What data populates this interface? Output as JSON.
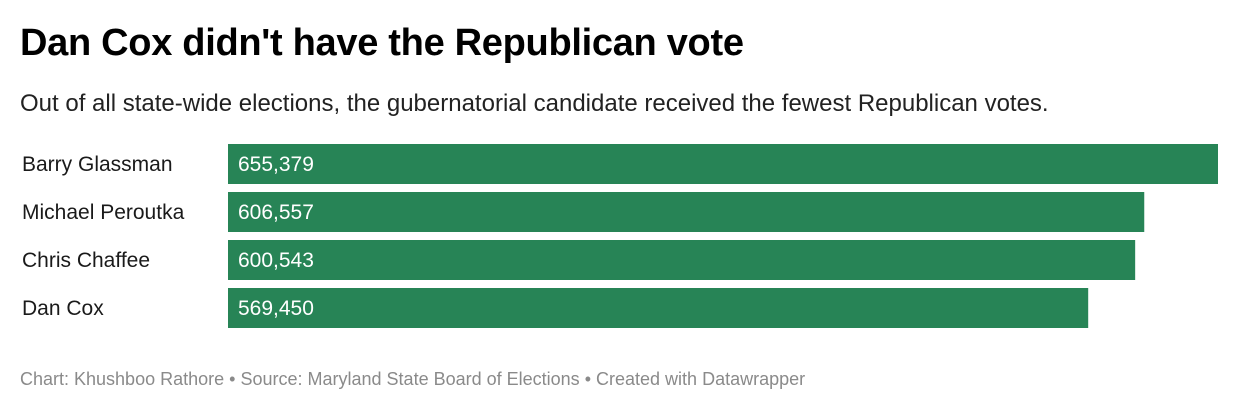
{
  "header": {
    "title": "Dan Cox didn't have the Republican vote",
    "subtitle": "Out of all state-wide elections, the gubernatorial candidate received the fewest Republican votes."
  },
  "footer": {
    "chart_credit": "Chart: Khushboo Rathore",
    "separator": "•",
    "source": "Source: Maryland State Board of Elections",
    "created_with": "Created with Datawrapper"
  },
  "colors": {
    "bar": "#278456",
    "bar_label": "#ffffff",
    "category_label": "#1a1a1a"
  },
  "chart_data": {
    "type": "bar",
    "orientation": "horizontal",
    "categories": [
      "Barry Glassman",
      "Michael Peroutka",
      "Chris Chaffee",
      "Dan Cox"
    ],
    "values": [
      655379,
      606557,
      600543,
      569450
    ],
    "value_labels": [
      "655,379",
      "606,557",
      "600,543",
      "569,450"
    ],
    "title": "Dan Cox didn't have the Republican vote",
    "xlim": [
      0,
      655379
    ],
    "grid": false,
    "legend": "none"
  }
}
